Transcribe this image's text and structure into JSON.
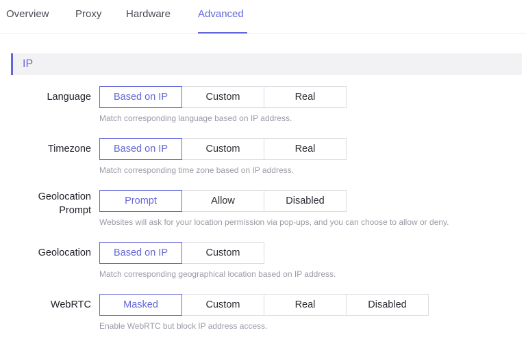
{
  "tabs": [
    {
      "label": "Overview"
    },
    {
      "label": "Proxy"
    },
    {
      "label": "Hardware"
    },
    {
      "label": "Advanced"
    }
  ],
  "active_tab": "Advanced",
  "section": {
    "title": "IP"
  },
  "rows": {
    "language": {
      "label": "Language",
      "options": [
        "Based on IP",
        "Custom",
        "Real"
      ],
      "selected": "Based on IP",
      "hint": "Match corresponding language based on IP address."
    },
    "timezone": {
      "label": "Timezone",
      "options": [
        "Based on IP",
        "Custom",
        "Real"
      ],
      "selected": "Based on IP",
      "hint": "Match corresponding time zone based on IP address."
    },
    "geolocation_prompt": {
      "label_line1": "Geolocation",
      "label_line2": "Prompt",
      "options": [
        "Prompt",
        "Allow",
        "Disabled"
      ],
      "selected": "Prompt",
      "hint": "Websites will ask for your location permission via pop-ups, and you can choose to allow or deny."
    },
    "geolocation": {
      "label": "Geolocation",
      "options": [
        "Based on IP",
        "Custom"
      ],
      "selected": "Based on IP",
      "hint": "Match corresponding geographical location based on IP address."
    },
    "webrtc": {
      "label": "WebRTC",
      "options": [
        "Masked",
        "Custom",
        "Real",
        "Disabled"
      ],
      "selected": "Masked",
      "hint": "Enable WebRTC but block IP address access."
    }
  },
  "colors": {
    "accent": "#6366d8",
    "border": "#dcdce3",
    "hint": "#9a9aa6"
  }
}
